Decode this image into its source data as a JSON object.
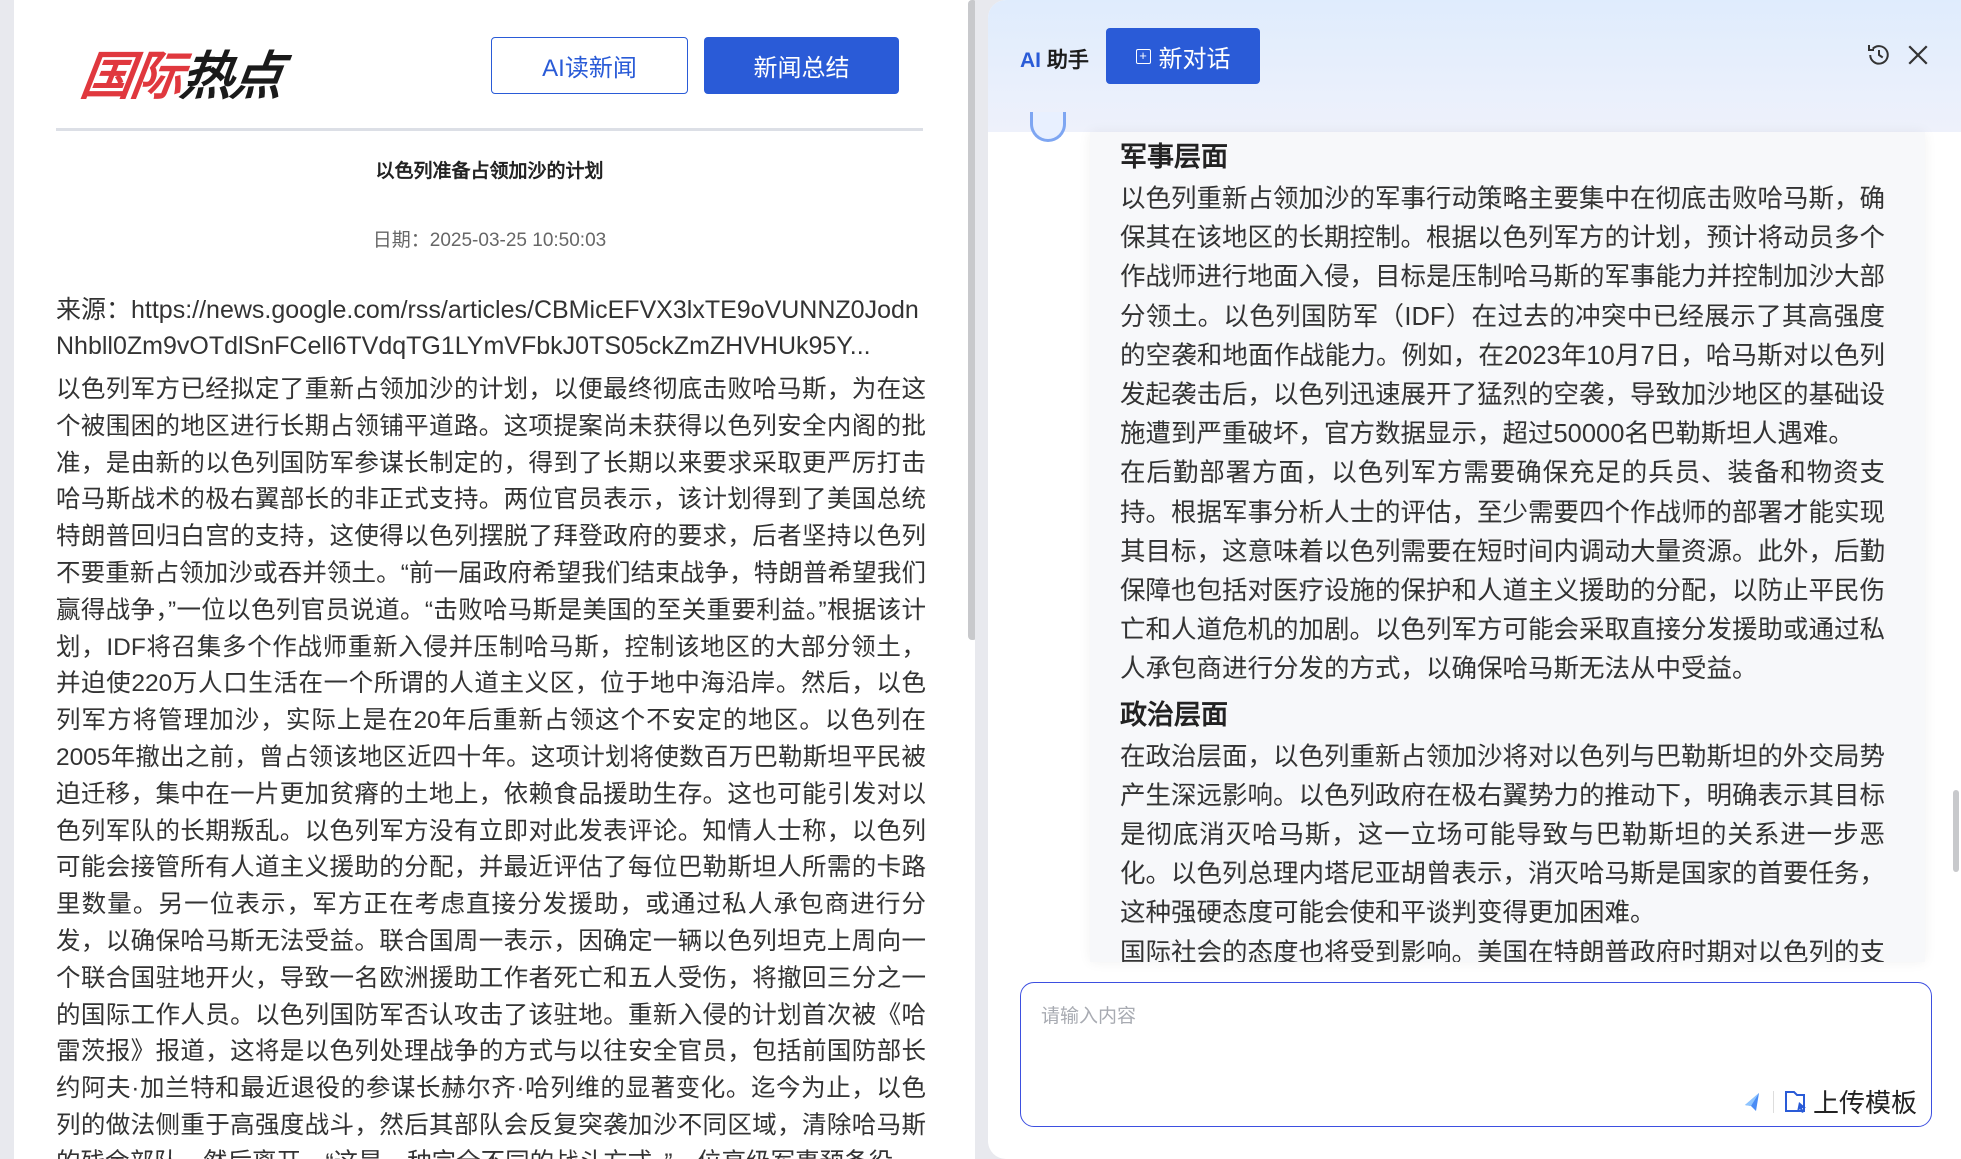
{
  "left": {
    "logo": {
      "part1": "国际",
      "part2": "热点"
    },
    "buttons": {
      "read": "AI读新闻",
      "summary": "新闻总结"
    },
    "article": {
      "title": "以色列准备占领加沙的计划",
      "date": "日期：2025-03-25 10:50:03",
      "source_label": "来源：",
      "source_url": "https://news.google.com/rss/articles/CBMicEFVX3lxTE9oVUNNZ0JodnNhbll0Zm9vOTdlSnFCell6TVdqTG1LYmVFbkJ0TS05ckZmZHVHUk95Y...",
      "body": "以色列军方已经拟定了重新占领加沙的计划，以便最终彻底击败哈马斯，为在这个被围困的地区进行长期占领铺平道路。这项提案尚未获得以色列安全内阁的批准，是由新的以色列国防军参谋长制定的，得到了长期以来要求采取更严厉打击哈马斯战术的极右翼部长的非正式支持。两位官员表示，该计划得到了美国总统特朗普回归白宫的支持，这使得以色列摆脱了拜登政府的要求，后者坚持以色列不要重新占领加沙或吞并领土。“前一届政府希望我们结束战争，特朗普希望我们赢得战争，”一位以色列官员说道。“击败哈马斯是美国的至关重要利益。”根据该计划，IDF将召集多个作战师重新入侵并压制哈马斯，控制该地区的大部分领土，并迫使220万人口生活在一个所谓的人道主义区，位于地中海沿岸。然后，以色列军方将管理加沙，实际上是在20年后重新占领这个不安定的地区。以色列在2005年撤出之前，曾占领该地区近四十年。这项计划将使数百万巴勒斯坦平民被迫迁移，集中在一片更加贫瘠的土地上，依赖食品援助生存。这也可能引发对以色列军队的长期叛乱。以色列军方没有立即对此发表评论。知情人士称，以色列可能会接管所有人道主义援助的分配，并最近评估了每位巴勒斯坦人所需的卡路里数量。另一位表示，军方正在考虑直接分发援助，或通过私人承包商进行分发，以确保哈马斯无法受益。联合国周一表示，因确定一辆以色列坦克上周向一个联合国驻地开火，导致一名欧洲援助工作者死亡和五人受伤，将撤回三分之一的国际工作人员。以色列国防军否认攻击了该驻地。重新入侵的计划首次被《哈雷茨报》报道，这将是以色列处理战争的方式与以往安全官员，包括前国防部长约阿夫·加兰特和最近退役的参谋长赫尔齐·哈列维的显著变化。迄今为止，以色列的做法侧重于高强度战斗，然后其部队会反复突袭加沙不同区域，清除哈马斯的残余部队，然后离开。“这是一种完全不同的战斗方式，”一位高级军事预备役"
    }
  },
  "assistant": {
    "label_ai": "AI",
    "label_rest": " 助手",
    "new_chat": "新对话",
    "sections": [
      {
        "heading": "军事层面",
        "paragraphs": [
          "以色列重新占领加沙的军事行动策略主要集中在彻底击败哈马斯，确保其在该地区的长期控制。根据以色列军方的计划，预计将动员多个作战师进行地面入侵，目标是压制哈马斯的军事能力并控制加沙大部分领土。以色列国防军（IDF）在过去的冲突中已经展示了其高强度的空袭和地面作战能力。例如，在2023年10月7日，哈马斯对以色列发起袭击后，以色列迅速展开了猛烈的空袭，导致加沙地区的基础设施遭到严重破坏，官方数据显示，超过50000名巴勒斯坦人遇难。",
          "在后勤部署方面，以色列军方需要确保充足的兵员、装备和物资支持。根据军事分析人士的评估，至少需要四个作战师的部署才能实现其目标，这意味着以色列需要在短时间内调动大量资源。此外，后勤保障也包括对医疗设施的保护和人道主义援助的分配，以防止平民伤亡和人道危机的加剧。以色列军方可能会采取直接分发援助或通过私人承包商进行分发的方式，以确保哈马斯无法从中受益。"
        ]
      },
      {
        "heading": "政治层面",
        "paragraphs": [
          "在政治层面，以色列重新占领加沙将对以色列与巴勒斯坦的外交局势产生深远影响。以色列政府在极右翼势力的推动下，明确表示其目标是彻底消灭哈马斯，这一立场可能导致与巴勒斯坦的关系进一步恶化。以色列总理内塔尼亚胡曾表示，消灭哈马斯是国家的首要任务，这种强硬态度可能会使和平谈判变得更加困难。",
          "国际社会的态度也将受到影响。美国在特朗普政府时期对以色列的支持"
        ]
      }
    ],
    "input_placeholder": "请输入内容",
    "upload_label": "上传模板"
  },
  "colors": {
    "primary": "#2a5bd7",
    "logo_red": "#e0383e",
    "input_border": "#3d4fe0"
  }
}
